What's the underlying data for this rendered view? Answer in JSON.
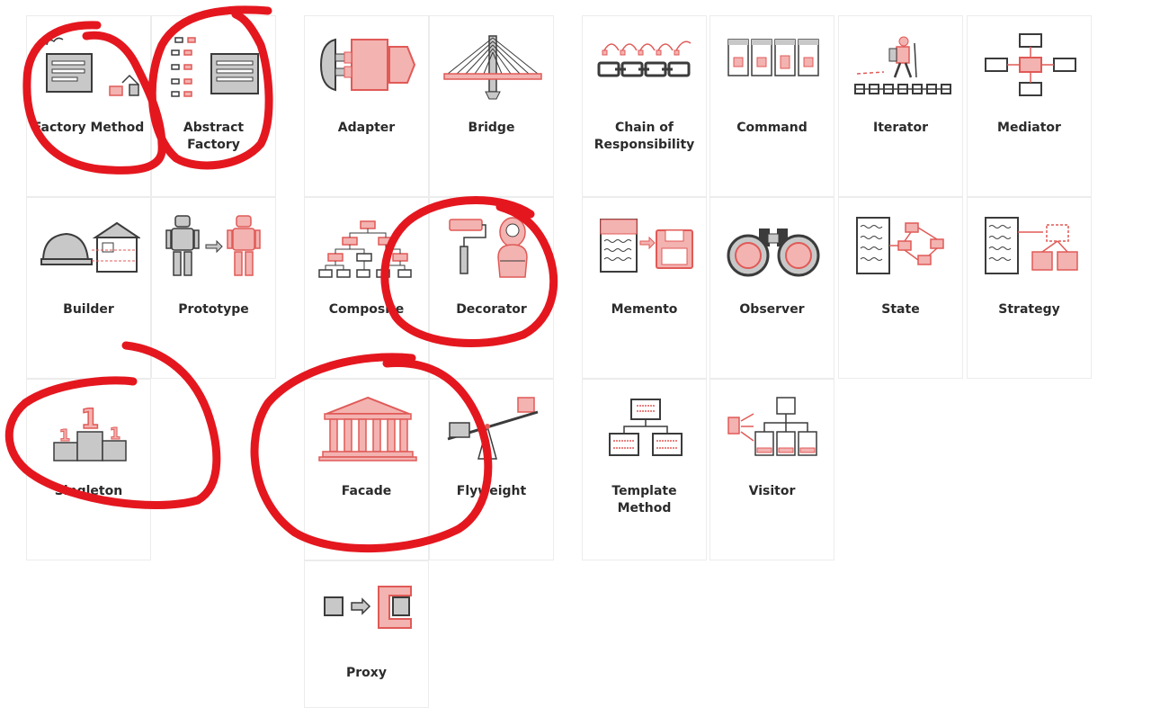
{
  "colors": {
    "accent": "#e05a57",
    "accent_light": "#f3b3b1",
    "gray": "#c8c8c8",
    "dark": "#3b3b3b",
    "annotation": "#e4171f"
  },
  "creational": [
    {
      "label": "Factory Method",
      "icon": "factory-icon"
    },
    {
      "label": "Abstract Factory",
      "icon": "factory-tree-icon"
    },
    {
      "label": "Builder",
      "icon": "hardhat-house-icon"
    },
    {
      "label": "Prototype",
      "icon": "robot-clone-icon"
    },
    {
      "label": "Singleton",
      "icon": "podium-icon"
    }
  ],
  "structural": [
    {
      "label": "Adapter",
      "icon": "adapter-plug-icon"
    },
    {
      "label": "Bridge",
      "icon": "bridge-icon"
    },
    {
      "label": "Composite",
      "icon": "tree-hierarchy-icon"
    },
    {
      "label": "Decorator",
      "icon": "paint-roller-doll-icon"
    },
    {
      "label": "Facade",
      "icon": "temple-icon"
    },
    {
      "label": "Flyweight",
      "icon": "seesaw-icon"
    },
    {
      "label": "Proxy",
      "icon": "proxy-bracket-icon"
    }
  ],
  "behavioral": [
    {
      "label": "Chain of Responsibility",
      "icon": "chain-icon"
    },
    {
      "label": "Command",
      "icon": "command-cards-icon"
    },
    {
      "label": "Iterator",
      "icon": "hiker-path-icon"
    },
    {
      "label": "Mediator",
      "icon": "mediator-hub-icon"
    },
    {
      "label": "Memento",
      "icon": "floppy-doc-icon"
    },
    {
      "label": "Observer",
      "icon": "binoculars-icon"
    },
    {
      "label": "State",
      "icon": "state-graph-icon"
    },
    {
      "label": "Strategy",
      "icon": "strategy-options-icon"
    },
    {
      "label": "Template Method",
      "icon": "template-tree-icon"
    },
    {
      "label": "Visitor",
      "icon": "visitor-arrows-icon"
    }
  ]
}
